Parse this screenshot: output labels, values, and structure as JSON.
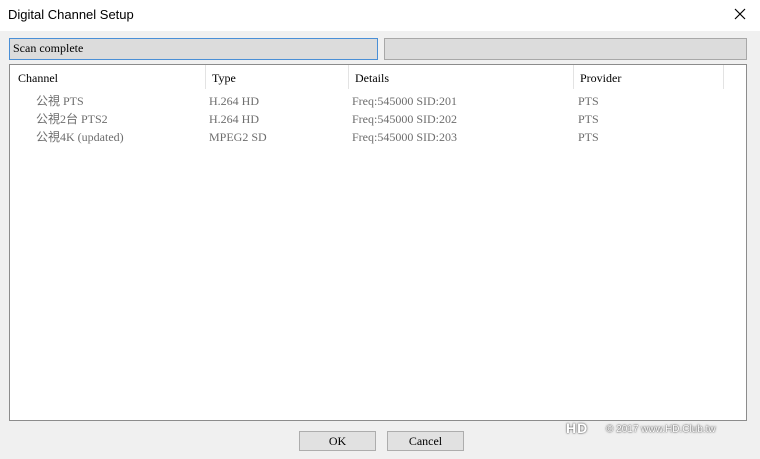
{
  "window": {
    "title": "Digital Channel Setup",
    "close_glyph": "✕"
  },
  "status": {
    "left_text": "Scan complete",
    "right_text": ""
  },
  "list": {
    "columns": [
      "Channel",
      "Type",
      "Details",
      "Provider"
    ],
    "rows": [
      {
        "channel": "公視 PTS",
        "type": "H.264 HD",
        "details": "Freq:545000 SID:201",
        "provider": "PTS"
      },
      {
        "channel": "公視2台 PTS2",
        "type": "H.264 HD",
        "details": "Freq:545000 SID:202",
        "provider": "PTS"
      },
      {
        "channel": "公視4K  (updated)",
        "type": "MPEG2 SD",
        "details": "Freq:545000 SID:203",
        "provider": "PTS"
      }
    ]
  },
  "buttons": {
    "ok": "OK",
    "cancel": "Cancel"
  },
  "watermark": {
    "logo": "HD",
    "text": "© 2017 www.HD.Club.tw"
  }
}
